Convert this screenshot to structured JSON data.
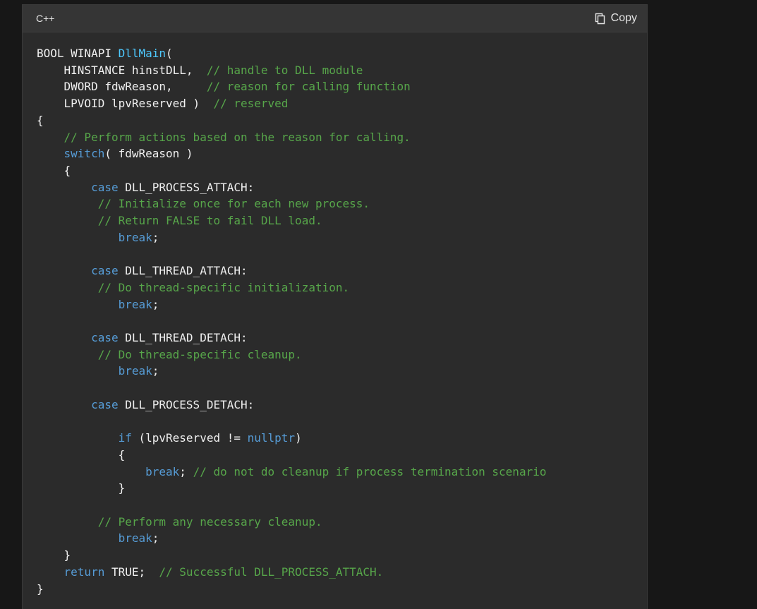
{
  "header": {
    "language_label": "C++",
    "copy_label": "Copy",
    "copy_icon": "copy-icon"
  },
  "colors": {
    "background": "#171717",
    "card": "#2b2b2b",
    "header": "#353535",
    "keyword": "#569cd6",
    "function": "#4ec9ff",
    "comment": "#57a64a",
    "plain": "#f0f0f0"
  },
  "code_lines": [
    [
      {
        "t": "pl",
        "v": "BOOL WINAPI "
      },
      {
        "t": "fn",
        "v": "DllMain"
      },
      {
        "t": "pl",
        "v": "("
      }
    ],
    [
      {
        "t": "pl",
        "v": "    HINSTANCE hinstDLL,  "
      },
      {
        "t": "cm",
        "v": "// handle to DLL module"
      }
    ],
    [
      {
        "t": "pl",
        "v": "    DWORD fdwReason,     "
      },
      {
        "t": "cm",
        "v": "// reason for calling function"
      }
    ],
    [
      {
        "t": "pl",
        "v": "    LPVOID lpvReserved )  "
      },
      {
        "t": "cm",
        "v": "// reserved"
      }
    ],
    [
      {
        "t": "pl",
        "v": "{"
      }
    ],
    [
      {
        "t": "pl",
        "v": "    "
      },
      {
        "t": "cm",
        "v": "// Perform actions based on the reason for calling."
      }
    ],
    [
      {
        "t": "pl",
        "v": "    "
      },
      {
        "t": "kw",
        "v": "switch"
      },
      {
        "t": "pl",
        "v": "( fdwReason )"
      }
    ],
    [
      {
        "t": "pl",
        "v": "    {"
      }
    ],
    [
      {
        "t": "pl",
        "v": "        "
      },
      {
        "t": "kw",
        "v": "case"
      },
      {
        "t": "pl",
        "v": " DLL_PROCESS_ATTACH:"
      }
    ],
    [
      {
        "t": "pl",
        "v": "         "
      },
      {
        "t": "cm",
        "v": "// Initialize once for each new process."
      }
    ],
    [
      {
        "t": "pl",
        "v": "         "
      },
      {
        "t": "cm",
        "v": "// Return FALSE to fail DLL load."
      }
    ],
    [
      {
        "t": "pl",
        "v": "            "
      },
      {
        "t": "kw",
        "v": "break"
      },
      {
        "t": "pl",
        "v": ";"
      }
    ],
    [
      {
        "t": "pl",
        "v": ""
      }
    ],
    [
      {
        "t": "pl",
        "v": "        "
      },
      {
        "t": "kw",
        "v": "case"
      },
      {
        "t": "pl",
        "v": " DLL_THREAD_ATTACH:"
      }
    ],
    [
      {
        "t": "pl",
        "v": "         "
      },
      {
        "t": "cm",
        "v": "// Do thread-specific initialization."
      }
    ],
    [
      {
        "t": "pl",
        "v": "            "
      },
      {
        "t": "kw",
        "v": "break"
      },
      {
        "t": "pl",
        "v": ";"
      }
    ],
    [
      {
        "t": "pl",
        "v": ""
      }
    ],
    [
      {
        "t": "pl",
        "v": "        "
      },
      {
        "t": "kw",
        "v": "case"
      },
      {
        "t": "pl",
        "v": " DLL_THREAD_DETACH:"
      }
    ],
    [
      {
        "t": "pl",
        "v": "         "
      },
      {
        "t": "cm",
        "v": "// Do thread-specific cleanup."
      }
    ],
    [
      {
        "t": "pl",
        "v": "            "
      },
      {
        "t": "kw",
        "v": "break"
      },
      {
        "t": "pl",
        "v": ";"
      }
    ],
    [
      {
        "t": "pl",
        "v": ""
      }
    ],
    [
      {
        "t": "pl",
        "v": "        "
      },
      {
        "t": "kw",
        "v": "case"
      },
      {
        "t": "pl",
        "v": " DLL_PROCESS_DETACH:"
      }
    ],
    [
      {
        "t": "pl",
        "v": ""
      }
    ],
    [
      {
        "t": "pl",
        "v": "            "
      },
      {
        "t": "kw",
        "v": "if"
      },
      {
        "t": "pl",
        "v": " (lpvReserved != "
      },
      {
        "t": "kw",
        "v": "nullptr"
      },
      {
        "t": "pl",
        "v": ")"
      }
    ],
    [
      {
        "t": "pl",
        "v": "            {"
      }
    ],
    [
      {
        "t": "pl",
        "v": "                "
      },
      {
        "t": "kw",
        "v": "break"
      },
      {
        "t": "pl",
        "v": "; "
      },
      {
        "t": "cm",
        "v": "// do not do cleanup if process termination scenario"
      }
    ],
    [
      {
        "t": "pl",
        "v": "            }"
      }
    ],
    [
      {
        "t": "pl",
        "v": ""
      }
    ],
    [
      {
        "t": "pl",
        "v": "         "
      },
      {
        "t": "cm",
        "v": "// Perform any necessary cleanup."
      }
    ],
    [
      {
        "t": "pl",
        "v": "            "
      },
      {
        "t": "kw",
        "v": "break"
      },
      {
        "t": "pl",
        "v": ";"
      }
    ],
    [
      {
        "t": "pl",
        "v": "    }"
      }
    ],
    [
      {
        "t": "pl",
        "v": "    "
      },
      {
        "t": "kw",
        "v": "return"
      },
      {
        "t": "pl",
        "v": " TRUE;  "
      },
      {
        "t": "cm",
        "v": "// Successful DLL_PROCESS_ATTACH."
      }
    ],
    [
      {
        "t": "pl",
        "v": "}"
      }
    ]
  ]
}
